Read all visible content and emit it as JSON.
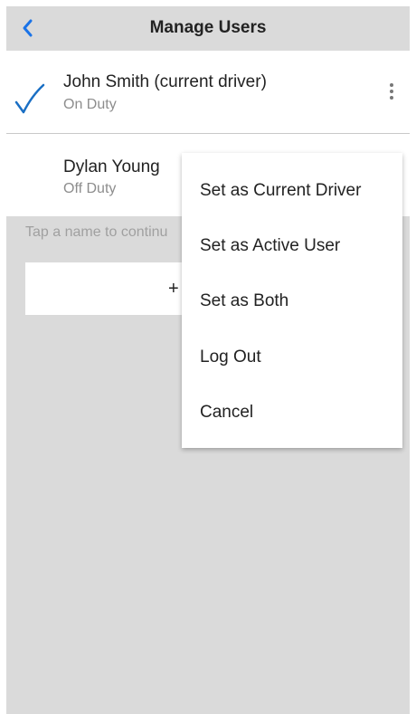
{
  "header": {
    "title": "Manage Users",
    "back_icon": "chevron-left-icon",
    "accent_color": "#1a73e8"
  },
  "users": [
    {
      "name": "John Smith (current driver)",
      "status": "On Duty",
      "selected": true
    },
    {
      "name": "Dylan Young",
      "status": "Off Duty",
      "selected": false
    }
  ],
  "hint": "Tap a name to continu",
  "add_button": {
    "label": "+"
  },
  "context_menu": {
    "items": [
      "Set as Current Driver",
      "Set as Active User",
      "Set as Both",
      "Log Out",
      "Cancel"
    ]
  }
}
